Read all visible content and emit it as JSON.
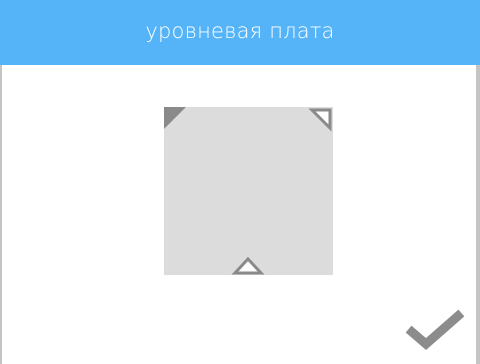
{
  "header": {
    "title": "уровневая плата"
  },
  "bed": {
    "points": [
      {
        "name": "front-left",
        "state": "done",
        "icon": "corner-triangle-filled"
      },
      {
        "name": "front-right",
        "state": "pending",
        "icon": "corner-triangle-outline"
      },
      {
        "name": "back-center",
        "state": "pending",
        "icon": "triangle-outline"
      }
    ]
  },
  "actions": {
    "confirm_icon": "checkmark-icon"
  },
  "colors": {
    "header_bg": "#55b4f8",
    "header_text": "#ffffff",
    "bed_fill": "#dcdcdc",
    "marker": "#8a8a8a",
    "checkmark": "#8c8c8c"
  }
}
